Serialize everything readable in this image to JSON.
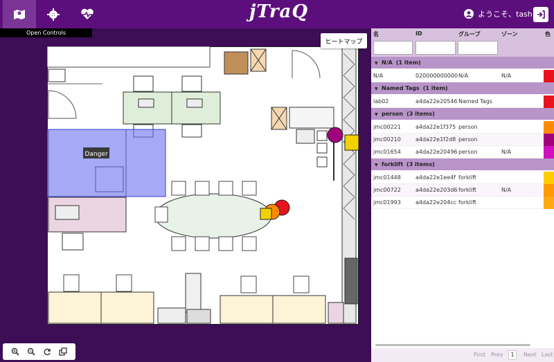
{
  "header": {
    "logo": "jTraQ",
    "welcome": "ようこそ、tash"
  },
  "nav": {
    "map_icon": "map-icon",
    "settings_icon": "gear-icon",
    "health_icon": "heartbeat-icon"
  },
  "controls": {
    "open_controls": "Open Controls"
  },
  "map": {
    "heatmap_button": "ヒートマップ",
    "danger_zone_label": "Danger"
  },
  "table": {
    "columns": [
      "名",
      "ID",
      "グループ",
      "ゾーン",
      "色"
    ],
    "groups": [
      {
        "label": "N/A",
        "count": "(1 item)",
        "rows": [
          {
            "name": "N/A",
            "id": "020000000000",
            "group": "N/A",
            "zone": "N/A",
            "color": "#e8131d"
          }
        ]
      },
      {
        "label": "Named Tags",
        "count": "(1 item)",
        "rows": [
          {
            "name": "lab02",
            "id": "a4da22e20546",
            "group": "Named Tags",
            "zone": "",
            "color": "#e8131d"
          }
        ]
      },
      {
        "label": "person",
        "count": "(3 items)",
        "rows": [
          {
            "name": "jmc00221",
            "id": "a4da22e1f375",
            "group": "person",
            "zone": "",
            "color": "#ff8a00"
          },
          {
            "name": "jmc00210",
            "id": "a4da22e1f2d8",
            "group": "person",
            "zone": "",
            "color": "#a0007a"
          },
          {
            "name": "jmc01654",
            "id": "a4da22e20496",
            "group": "person",
            "zone": "N/A",
            "color": "#d010c0"
          }
        ]
      },
      {
        "label": "forklift",
        "count": "(3 items)",
        "rows": [
          {
            "name": "jmc01448",
            "id": "a4da22e1ee4f",
            "group": "forklift",
            "zone": "",
            "color": "#ffcc00"
          },
          {
            "name": "jmc00722",
            "id": "a4da22e203d6",
            "group": "forklift",
            "zone": "N/A",
            "color": "#ff9a00"
          },
          {
            "name": "jmc01993",
            "id": "a4da22e204cc",
            "group": "forklift",
            "zone": "",
            "color": "#ffaa10"
          }
        ]
      }
    ],
    "pager": {
      "first": "First",
      "prev": "Prev",
      "page": "1",
      "next": "Next",
      "last": "Last"
    }
  },
  "colors": {
    "brand": "#5c0f7c",
    "accent": "#f2d200",
    "danger_zone": "#6a6ff0"
  }
}
